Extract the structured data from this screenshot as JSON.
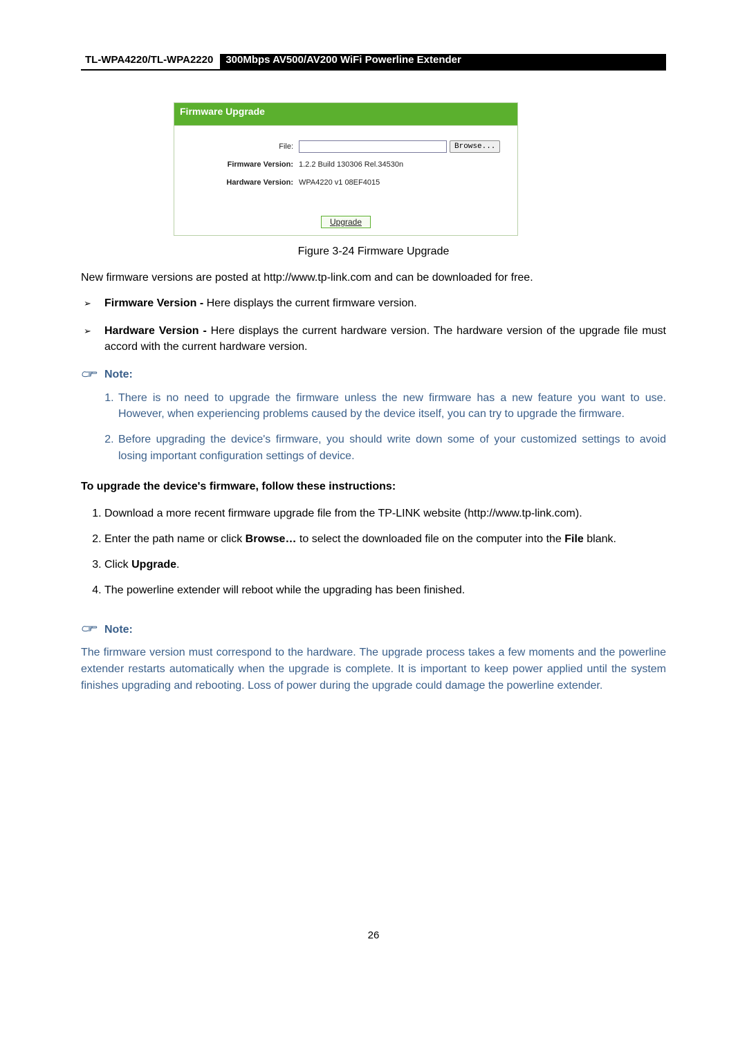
{
  "header": {
    "model": "TL-WPA4220/TL-WPA2220",
    "product": "300Mbps AV500/AV200 WiFi Powerline Extender"
  },
  "panel": {
    "title": "Firmware Upgrade",
    "file_label": "File:",
    "file_value": "",
    "browse_label": "Browse...",
    "fw_label": "Firmware Version:",
    "fw_value": "1.2.2 Build 130306 Rel.34530n",
    "hw_label": "Hardware Version:",
    "hw_value": "WPA4220 v1 08EF4015",
    "upgrade_label": "Upgrade"
  },
  "caption": "Figure 3-24 Firmware Upgrade",
  "intro": "New firmware versions are posted at http://www.tp-link.com and can be downloaded for free.",
  "bullets": {
    "fw_bold": "Firmware Version -",
    "fw_rest": " Here displays the current firmware version.",
    "hw_bold": "Hardware Version -",
    "hw_rest": " Here displays the current hardware version. The hardware version of the upgrade file must accord with the current hardware version."
  },
  "note_label": "Note:",
  "notes1": {
    "n1": "There is no need to upgrade the firmware unless the new firmware has a new feature you want to use. However, when experiencing problems caused by the device itself, you can try to upgrade the firmware.",
    "n2": "Before upgrading the device's firmware, you should write down some of your customized settings to avoid losing important configuration settings of device."
  },
  "instr_heading": "To upgrade the device's firmware, follow these instructions:",
  "steps": {
    "s1": "Download a more recent firmware upgrade file from the TP-LINK website (http://www.tp-link.com).",
    "s2a": "Enter the path name or click ",
    "s2b": "Browse…",
    "s2c": " to select the downloaded file on the computer into the ",
    "s2d": "File",
    "s2e": " blank.",
    "s3a": "Click ",
    "s3b": "Upgrade",
    "s3c": ".",
    "s4": "The powerline extender will reboot while the upgrading has been finished."
  },
  "note2_para": "The firmware version must correspond to the hardware. The upgrade process takes a few moments and the powerline extender restarts automatically when the upgrade is complete. It is important to keep power applied until the system finishes upgrading and rebooting. Loss of power during the upgrade could damage the powerline extender.",
  "page_number": "26"
}
